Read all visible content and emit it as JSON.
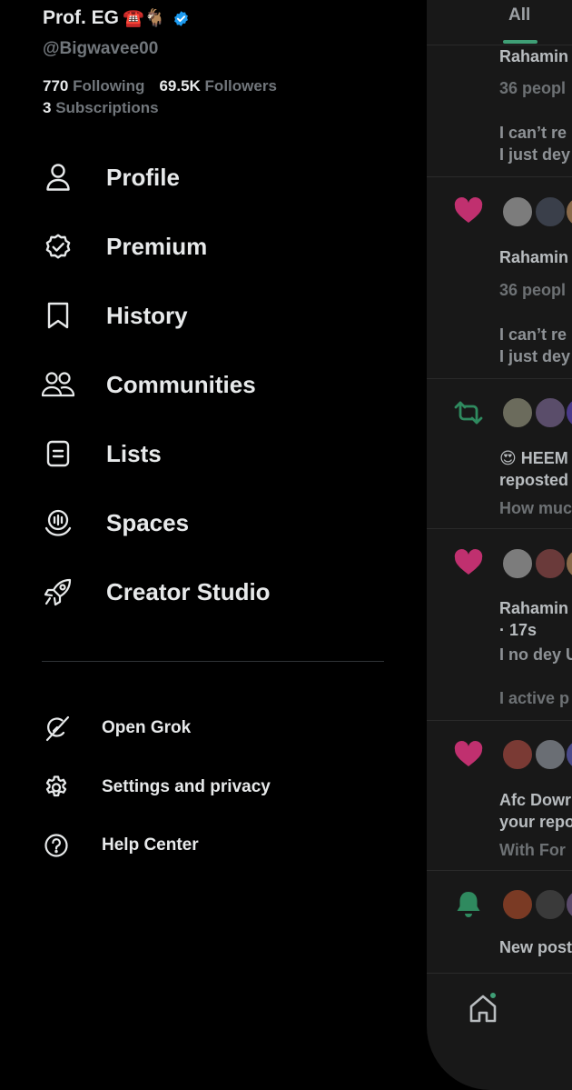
{
  "profile": {
    "name": "Prof. EG",
    "emoji": "☎️🐐",
    "handle": "@Bigwavee00",
    "following_count": "770",
    "following_label": "Following",
    "followers_count": "69.5K",
    "followers_label": "Followers",
    "subscriptions_count": "3",
    "subscriptions_label": "Subscriptions"
  },
  "menu": [
    {
      "label": "Profile",
      "icon": "person-icon"
    },
    {
      "label": "Premium",
      "icon": "premium-badge-icon"
    },
    {
      "label": "History",
      "icon": "bookmark-icon"
    },
    {
      "label": "Communities",
      "icon": "communities-icon"
    },
    {
      "label": "Lists",
      "icon": "list-icon"
    },
    {
      "label": "Spaces",
      "icon": "spaces-icon"
    },
    {
      "label": "Creator Studio",
      "icon": "rocket-icon"
    }
  ],
  "secondary_menu": [
    {
      "label": "Open Grok",
      "icon": "grok-icon"
    },
    {
      "label": "Settings and privacy",
      "icon": "gear-icon"
    },
    {
      "label": "Help Center",
      "icon": "help-icon"
    }
  ],
  "notifications_panel": {
    "tab_label": "All",
    "lines": {
      "n1a": "Rahamin",
      "n1b": "36 peopl",
      "n1c": "I can’t re",
      "n1d": "I just dey",
      "n2a": "Rahamin",
      "n2b": "36 peopl",
      "n2c": "I can’t re",
      "n2d": "I just dey",
      "n3a": "😍 HEEM",
      "n3b": "reposted",
      "n3c": "How muc",
      "n4a": "Rahamin",
      "n4b": "· 17s",
      "n4c": "I no dey U",
      "n4d": "I active p",
      "n5a": "Afc Dowr",
      "n5b": "your repo",
      "n5c": "With For",
      "n6a": "New post"
    }
  },
  "colors": {
    "background": "#000000",
    "panel": "#181818",
    "verified": "#1d9bf0",
    "like": "#c0306f",
    "repost": "#2f8a5f",
    "accent_green": "#3f9f76"
  }
}
